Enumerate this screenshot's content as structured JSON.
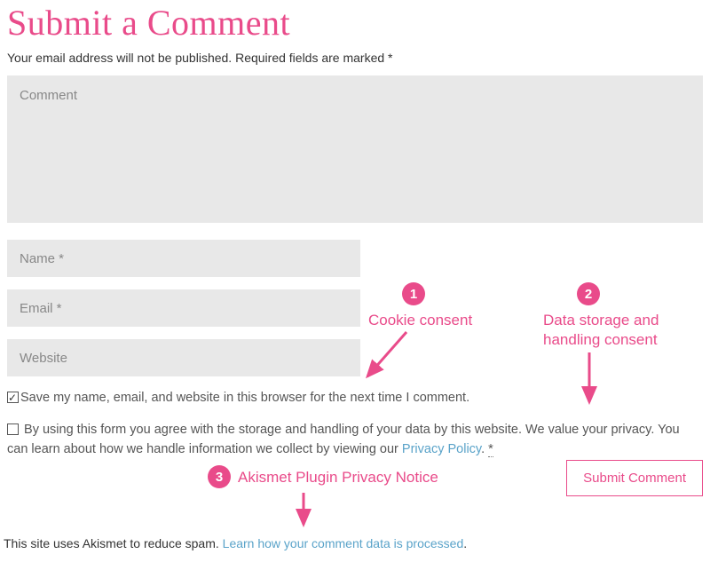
{
  "title": "Submit a Comment",
  "notice": "Your email address will not be published. Required fields are marked *",
  "fields": {
    "comment_placeholder": "Comment",
    "name_placeholder": "Name *",
    "email_placeholder": "Email *",
    "website_placeholder": "Website"
  },
  "consent": {
    "cookie": "Save my name, email, and website in this browser for the next time I comment.",
    "storage_prefix": " By using this form you agree with the storage and handling of your data by this website. We value your privacy. You can learn about how we handle information we collect by viewing our ",
    "privacy_link": "Privacy Policy",
    "storage_suffix": ". ",
    "asterisk": "*"
  },
  "submit_label": "Submit Comment",
  "akismet": {
    "prefix": "This site uses Akismet to reduce spam. ",
    "link": "Learn how your comment data is processed",
    "suffix": "."
  },
  "annotations": {
    "one": {
      "num": "1",
      "label": "Cookie consent"
    },
    "two": {
      "num": "2",
      "label": "Data storage and handling consent"
    },
    "three": {
      "num": "3",
      "label": "Akismet Plugin Privacy Notice"
    }
  }
}
